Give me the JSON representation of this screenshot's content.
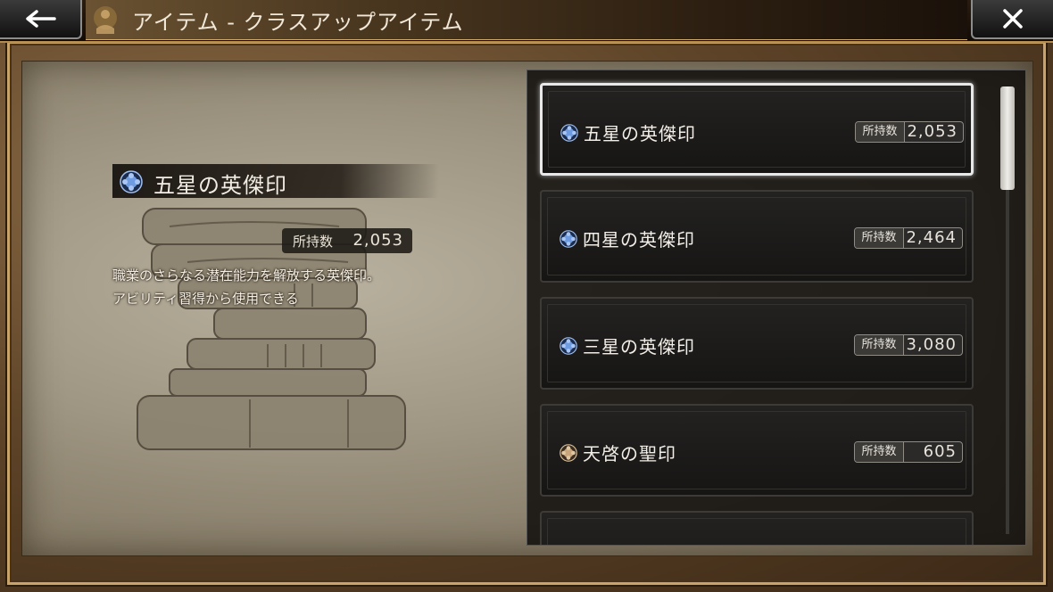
{
  "header": {
    "title": "アイテム - クラスアップアイテム",
    "back_icon": "back-arrow-icon",
    "close_icon": "close-icon"
  },
  "detail": {
    "name": "五星の英傑印",
    "owned_label": "所持数",
    "owned_value": "2,053",
    "description_line1": "職業のさらなる潜在能力を解放する英傑印。",
    "description_line2": "アビリティ習得から使用できる"
  },
  "items": [
    {
      "name": "五星の英傑印",
      "owned_label": "所持数",
      "owned_value": "2,053",
      "gem": "blue-gem-icon",
      "gem_color": "#7aa6e6",
      "selected": true
    },
    {
      "name": "四星の英傑印",
      "owned_label": "所持数",
      "owned_value": "2,464",
      "gem": "blue-gem-icon",
      "gem_color": "#7aa6e6",
      "selected": false
    },
    {
      "name": "三星の英傑印",
      "owned_label": "所持数",
      "owned_value": "3,080",
      "gem": "blue-gem-icon",
      "gem_color": "#7aa6e6",
      "selected": false
    },
    {
      "name": "天啓の聖印",
      "owned_label": "所持数",
      "owned_value": "605",
      "gem": "bronze-gem-icon",
      "gem_color": "#c8a57a",
      "selected": false
    }
  ],
  "colors": {
    "accent_gold": "#c9a46a",
    "selected_border": "#e8e8e8"
  }
}
